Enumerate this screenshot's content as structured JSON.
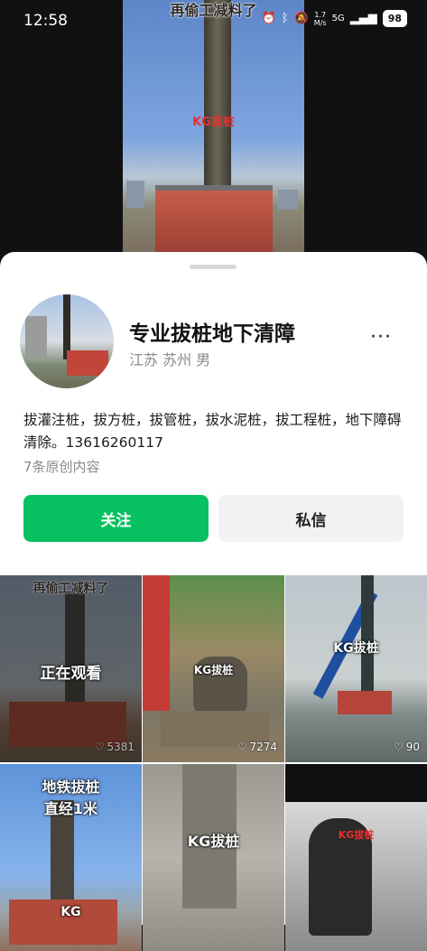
{
  "status_bar": {
    "time": "12:58",
    "speed_value": "1.7",
    "speed_unit": "M/s",
    "network": "5G",
    "battery": "98"
  },
  "video": {
    "caption": "再偷工减料了",
    "tag": "KG拔桩"
  },
  "profile": {
    "name": "专业拔桩地下清障",
    "meta": "江苏 苏州 男",
    "more": "···",
    "bio": "拔灌注桩，拔方桩，拔管桩，拔水泥桩，拔工程桩，地下障碍清除。13616260117",
    "count": "7条原创内容",
    "follow_label": "关注",
    "message_label": "私信"
  },
  "grid": [
    {
      "overlay_top": "再偷工减料了",
      "overlay_center": "正在观看",
      "likes": "5381"
    },
    {
      "tag": "KG拔桩",
      "likes": "7274"
    },
    {
      "tag": "KG拔桩",
      "likes": "90"
    },
    {
      "caption_line1": "地铁拔桩",
      "caption_line2": "直经1米",
      "tag": "KG"
    },
    {
      "tag": "KG拔桩"
    },
    {
      "tag": "KG拔桩"
    }
  ],
  "colors": {
    "accent": "#07c160",
    "secondary_button": "#f2f2f2"
  }
}
